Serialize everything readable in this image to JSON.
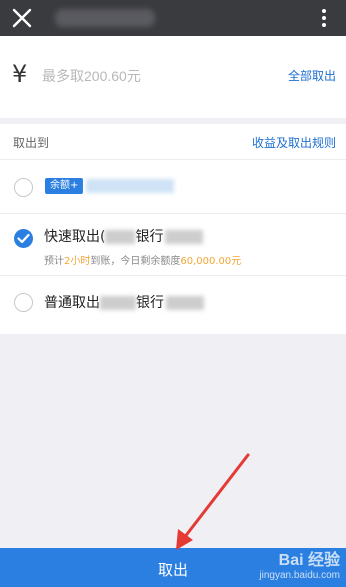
{
  "topbar": {
    "close_icon": "close-icon",
    "more_icon": "more-vertical-icon"
  },
  "amount": {
    "currency_symbol": "¥",
    "placeholder": "最多取200.60元",
    "withdraw_all_label": "全部取出"
  },
  "destination": {
    "section_label": "取出到",
    "rules_link": "收益及取出规则",
    "options": [
      {
        "badge": "余额+",
        "selected": false
      },
      {
        "title_prefix": "快速取出(",
        "title_bank": "银行",
        "eta_prefix": "预计",
        "eta_highlight": "2小时",
        "eta_mid": "到账，今日剩余额度",
        "eta_amount": "60,000.00元",
        "selected": true
      },
      {
        "title_prefix": "普通取出",
        "title_bank": "银行",
        "selected": false
      }
    ]
  },
  "submit": {
    "label": "取出"
  },
  "watermark": {
    "logo": "Bai 经验",
    "site": "jingyan.baidu.com"
  },
  "colors": {
    "accent": "#2b7fe0",
    "highlight": "#f2a735",
    "topbar": "#3a3b3f",
    "annotation_arrow": "#e53935"
  }
}
